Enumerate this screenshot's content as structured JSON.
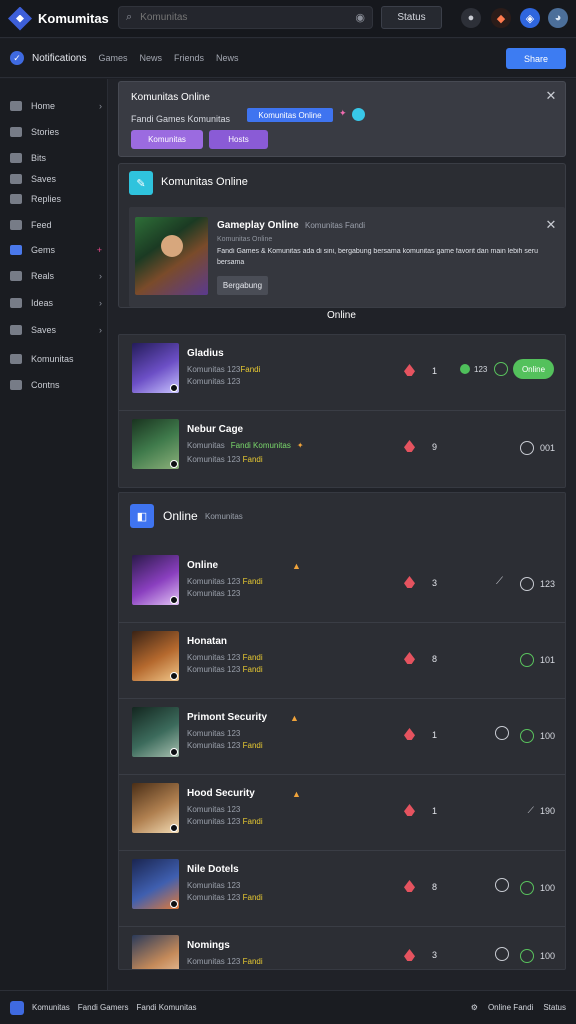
{
  "app": {
    "title": "Komumitas"
  },
  "search": {
    "placeholder": "Komunitas"
  },
  "header": {
    "button": "Status"
  },
  "subnav": {
    "title": "Notifications",
    "links": [
      "Games",
      "News",
      "Friends",
      "News"
    ],
    "primary_button": "Share"
  },
  "sidebar": {
    "items": [
      {
        "label": "Home",
        "chevron": "›"
      },
      {
        "label": "Stories",
        "chevron": ""
      },
      {
        "label": "Bits",
        "chevron": ""
      },
      {
        "label": "Saves",
        "chevron": ""
      },
      {
        "label": "Replies",
        "chevron": ""
      },
      {
        "label": "Feed",
        "chevron": ""
      },
      {
        "label": "Gems",
        "chevron": "+"
      },
      {
        "label": "Reals",
        "chevron": "›"
      },
      {
        "label": "Ideas",
        "chevron": "›"
      },
      {
        "label": "Saves",
        "chevron": "›"
      },
      {
        "label": "Komunitas",
        "chevron": ""
      },
      {
        "label": "Contns",
        "chevron": ""
      }
    ]
  },
  "alert": {
    "title": "Komunitas Online",
    "text": "Fandi Games  Komunitas",
    "badge": "Komunitas Online",
    "pill_primary": "Komunitas",
    "pill_secondary": "Hosts"
  },
  "notice": {
    "section_title": "Komunitas Online",
    "card_title": "Gameplay Online",
    "card_tag": "Komunitas Fandi",
    "card_subtitle": "Komunitas Online",
    "card_text": "Fandi Games & Komunitas ada di sini, bergabung bersama komunitas game favorit dan main lebih seru",
    "card_text2": "bersama",
    "card_button": "Bergabung"
  },
  "online_label": "Online",
  "list1": {
    "rows": [
      {
        "name": "Gladius",
        "meta1": "Komunitas  123",
        "meta1_a": "",
        "meta1_b": "Fandi",
        "meta2": "Komunitas  123",
        "meta2_b": "Fandi",
        "count": "1",
        "right": "123",
        "online": "Online",
        "av": "#3a2f78"
      },
      {
        "name": "Nebur Cage",
        "meta1": "Komunitas",
        "meta1_a": "Fandi Komunitas",
        "meta1_b": "",
        "meta2": "Komunitas  123",
        "meta2_b": "Fandi",
        "count": "9",
        "right": "001",
        "online": "",
        "av": "#2e5a33"
      }
    ]
  },
  "list2": {
    "section_title": "Online",
    "section_sub": "Komunitas",
    "rows": [
      {
        "name": "Online",
        "meta1": "Komunitas  123",
        "meta1_b": "Fandi",
        "meta2": "Komunitas  123",
        "meta2_b": "",
        "count": "3",
        "right": "123",
        "av": "#5a2a78"
      },
      {
        "name": "Honatan",
        "meta1": "Komunitas  123",
        "meta1_b": "Fandi",
        "meta2": "Komunitas  123",
        "meta2_b": "Fandi",
        "count": "8",
        "right": "101",
        "av": "#7a4222"
      },
      {
        "name": "Primont Security",
        "meta1": "Komunitas  123",
        "meta1_b": "",
        "meta2": "Komunitas  123",
        "meta2_b": "Fandi",
        "count": "1",
        "right": "100",
        "av": "#2f5a4e"
      },
      {
        "name": "Hood Security",
        "meta1": "Komunitas  123",
        "meta1_b": "",
        "meta2": "Komunitas  123",
        "meta2_b": "Fandi",
        "count": "1",
        "right": "190",
        "av": "#8b6a3a"
      },
      {
        "name": "Nile Dotels",
        "meta1": "Komunitas  123",
        "meta1_b": "",
        "meta2": "Komunitas  123",
        "meta2_b": "Fandi",
        "count": "8",
        "right": "100",
        "av": "#2b3f7a"
      },
      {
        "name": "Nomings",
        "meta1": "Komunitas  123",
        "meta1_b": "Fandi",
        "meta2": "",
        "meta2_b": "",
        "count": "3",
        "right": "100",
        "av": "#6a4e3a"
      }
    ]
  },
  "footer": {
    "label": "Komunitas",
    "links": [
      "Fandi Gamers",
      "Fandi Komunitas"
    ],
    "right_1": "Online Fandi",
    "right_2": "Status"
  },
  "colors": {
    "accent": "#3d7cf2",
    "purple": "#9b6be0",
    "green": "#4fc05b",
    "flame": "#e5535f"
  }
}
